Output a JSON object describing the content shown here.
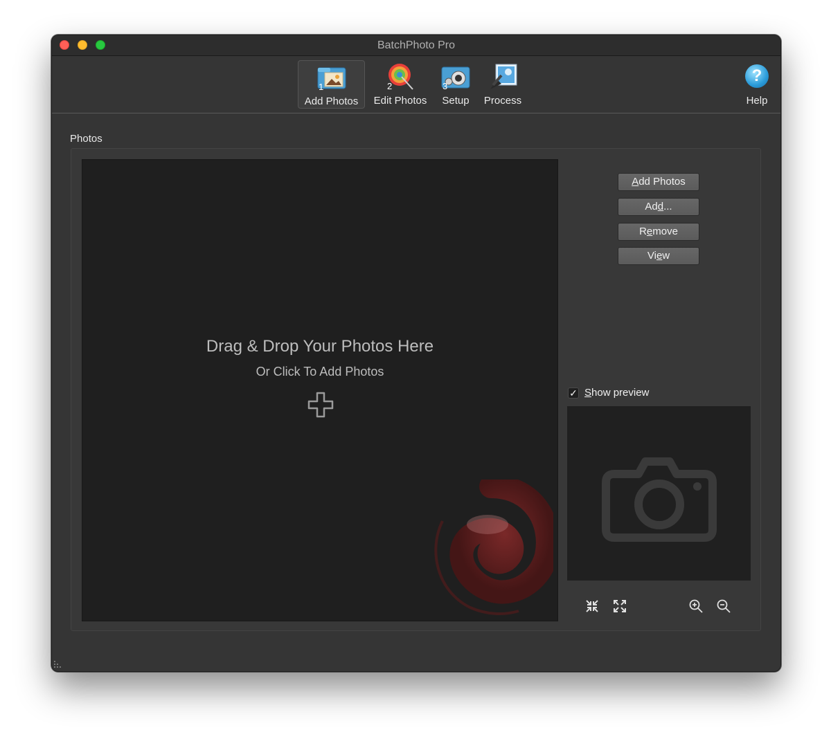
{
  "window": {
    "title": "BatchPhoto Pro"
  },
  "toolbar": {
    "tools": [
      {
        "label": "Add Photos",
        "icon": "add-photos-step-1-icon",
        "step": "1",
        "active": true
      },
      {
        "label": "Edit Photos",
        "icon": "edit-photos-step-2-icon",
        "step": "2",
        "active": false
      },
      {
        "label": "Setup",
        "icon": "setup-step-3-icon",
        "step": "3",
        "active": false
      },
      {
        "label": "Process",
        "icon": "process-icon",
        "active": false
      }
    ],
    "help": {
      "label": "Help",
      "icon": "help-icon",
      "glyph": "?"
    }
  },
  "photos": {
    "section_label": "Photos",
    "drop_title": "Drag & Drop Your Photos Here",
    "drop_subtitle": "Or Click To Add Photos",
    "plus_icon": "plus-icon",
    "watermark_icon": "swirl-logo-icon"
  },
  "buttons": {
    "add_photos": {
      "pre": "",
      "mnemonic": "A",
      "post": "dd Photos"
    },
    "add": {
      "pre": "Ad",
      "mnemonic": "d",
      "post": "..."
    },
    "remove": {
      "pre": "R",
      "mnemonic": "e",
      "post": "move"
    },
    "view": {
      "pre": "Vi",
      "mnemonic": "e",
      "post": "w"
    }
  },
  "preview": {
    "show_preview": {
      "pre": "",
      "mnemonic": "S",
      "post": "how preview",
      "checked": true,
      "check_glyph": "✓"
    },
    "placeholder_icon": "camera-icon",
    "controls": [
      "shrink-icon",
      "expand-icon",
      "zoom-in-icon",
      "zoom-out-icon"
    ]
  },
  "colors": {
    "window_bg": "#353535",
    "drop_bg": "#1f1f1f",
    "text": "#e8e8e8",
    "accent_swirl": "#6e1f1f"
  }
}
